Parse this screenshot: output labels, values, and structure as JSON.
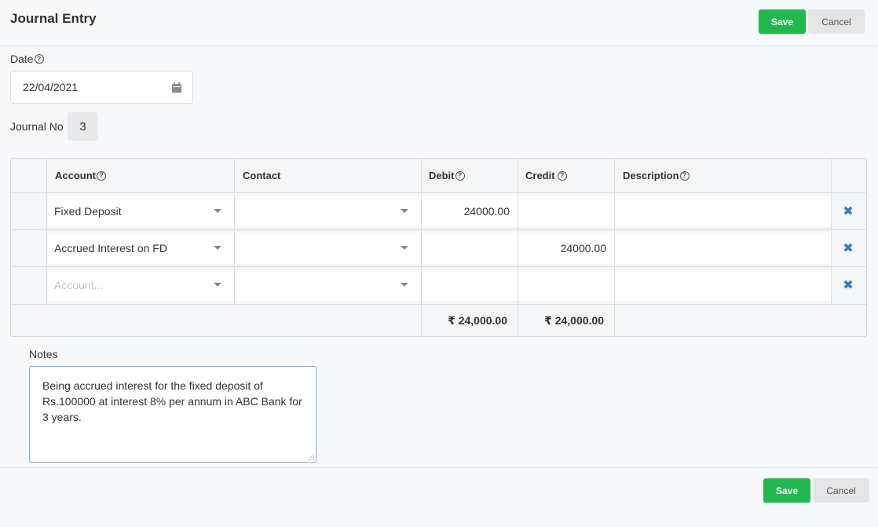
{
  "header": {
    "title": "Journal Entry",
    "save_label": "Save",
    "cancel_label": "Cancel"
  },
  "form": {
    "date_label": "Date",
    "date_value": "22/04/2021",
    "journal_no_label": "Journal No",
    "journal_no_value": "3"
  },
  "grid": {
    "columns": {
      "account": "Account",
      "contact": "Contact",
      "debit": "Debit",
      "credit": "Credit",
      "description": "Description"
    },
    "rows": [
      {
        "account": "Fixed Deposit",
        "contact": "",
        "debit": "24000.00",
        "credit": "",
        "description": ""
      },
      {
        "account": "Accrued Interest on FD",
        "contact": "",
        "debit": "",
        "credit": "24000.00",
        "description": ""
      },
      {
        "account": "",
        "contact": "",
        "debit": "",
        "credit": "",
        "description": ""
      }
    ],
    "account_placeholder": "Account...",
    "total_debit": "₹ 24,000.00",
    "total_credit": "₹ 24,000.00"
  },
  "notes": {
    "label": "Notes",
    "value": "Being accrued interest for the fixed deposit of Rs.100000 at interest 8% per annum in ABC Bank for 3 years."
  },
  "footer": {
    "save_label": "Save",
    "cancel_label": "Cancel"
  },
  "colors": {
    "save_green": "#21b94e",
    "delete_blue": "#3578c4",
    "focus_border": "#7fb0d9"
  }
}
